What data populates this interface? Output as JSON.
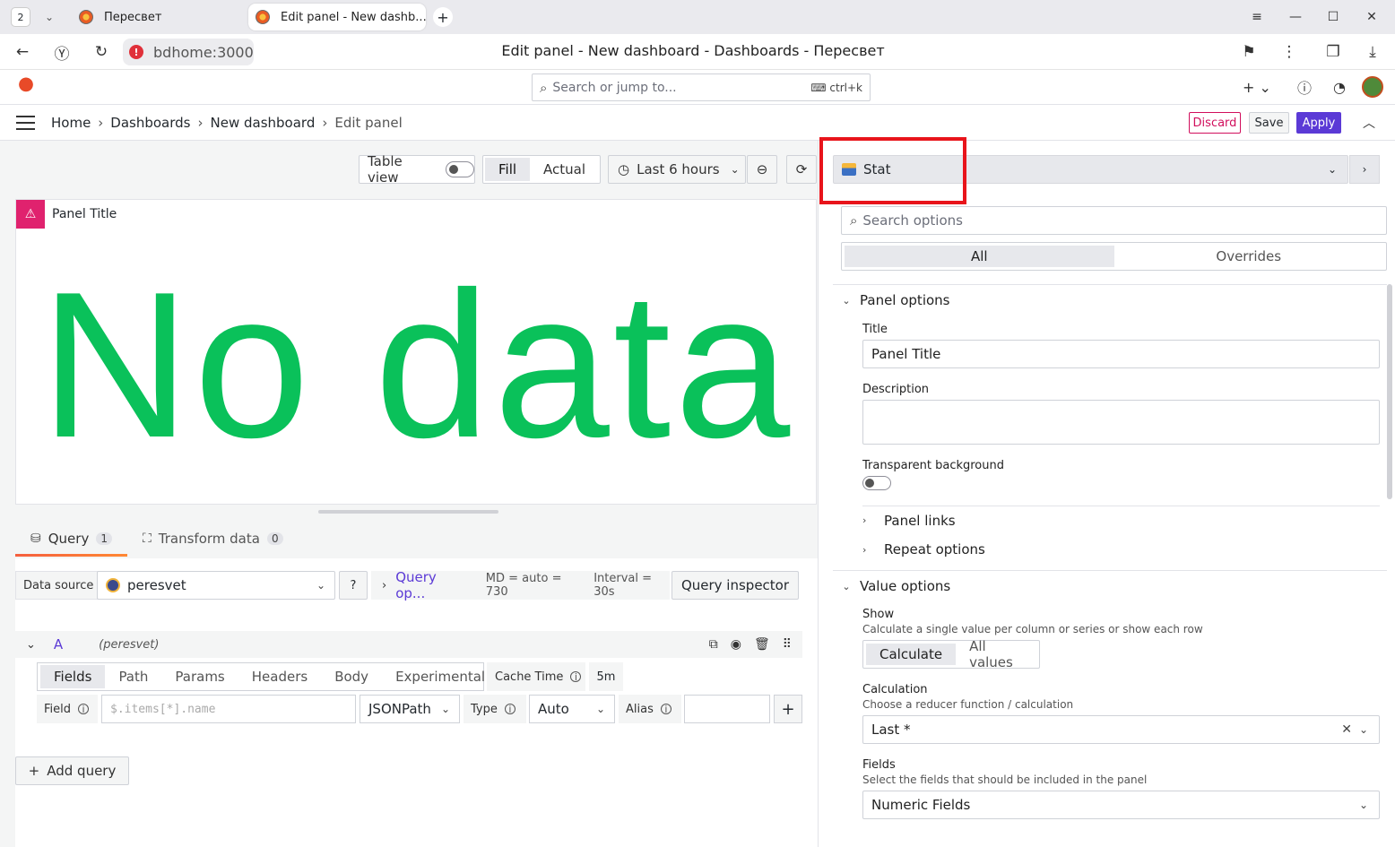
{
  "browser": {
    "tab_count": "2",
    "tabs": [
      {
        "title": "Пересвет"
      },
      {
        "title": "Edit panel - New dashb..."
      }
    ],
    "url_host": "bdhome:3000",
    "page_title": "Edit panel - New dashboard - Dashboards - Пересвет"
  },
  "topbar": {
    "search_placeholder": "Search or jump to...",
    "search_shortcut": "ctrl+k"
  },
  "breadcrumb": {
    "items": [
      "Home",
      "Dashboards",
      "New dashboard",
      "Edit panel"
    ],
    "discard": "Discard",
    "save": "Save",
    "apply": "Apply"
  },
  "toolbar": {
    "table_view": "Table view",
    "fill": "Fill",
    "actual": "Actual",
    "time_range": "Last 6 hours"
  },
  "panel": {
    "title": "Panel Title",
    "no_data": "No data"
  },
  "query_tabs": [
    {
      "label": "Query",
      "count": "1"
    },
    {
      "label": "Transform data",
      "count": "0"
    }
  ],
  "query": {
    "data_source_label": "Data source",
    "data_source": "peresvet",
    "query_options_link": "Query op...",
    "md": "MD = auto = 730",
    "interval": "Interval = 30s",
    "inspector": "Query inspector",
    "ref_id": "A",
    "ds_name": "(peresvet)",
    "sub_tabs": [
      "Fields",
      "Path",
      "Params",
      "Headers",
      "Body",
      "Experimental"
    ],
    "cache_time_label": "Cache Time",
    "cache_time_value": "5m",
    "field_label": "Field",
    "field_placeholder": "$.items[*].name",
    "field_type": "JSONPath",
    "type_label": "Type",
    "type_value": "Auto",
    "alias_label": "Alias",
    "add_query": "Add query"
  },
  "options": {
    "viz": "Stat",
    "search_placeholder": "Search options",
    "tabs": [
      "All",
      "Overrides"
    ],
    "panel_options": {
      "header": "Panel options",
      "title_label": "Title",
      "title_value": "Panel Title",
      "description_label": "Description",
      "transparent_label": "Transparent background",
      "panel_links": "Panel links",
      "repeat_options": "Repeat options"
    },
    "value_options": {
      "header": "Value options",
      "show_label": "Show",
      "show_desc": "Calculate a single value per column or series or show each row",
      "show_opts": [
        "Calculate",
        "All values"
      ],
      "calc_label": "Calculation",
      "calc_desc": "Choose a reducer function / calculation",
      "calc_value": "Last *",
      "fields_label": "Fields",
      "fields_desc": "Select the fields that should be included in the panel",
      "fields_value": "Numeric Fields"
    }
  },
  "colors": {
    "no_data_green": "#0ac15a",
    "accent_purple": "#5b3ad6",
    "discard_red": "#d10e5c",
    "highlight_red": "#e8141b"
  }
}
